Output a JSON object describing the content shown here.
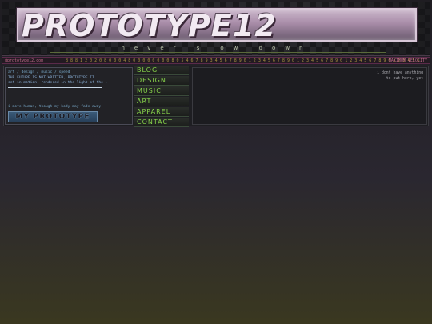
{
  "header": {
    "logo": "PROTOTYPE12",
    "tagline": "never slow down"
  },
  "infobar": {
    "left": "@prototype12.com",
    "middle": "8 8 8 1 2 0 2 0 8 0 0 0 4 8 0 0 0 0 0 0 0 0 8 0 5 4 6 7 8 9 3 4 5 6 7 8 9 0 1 2 3 4 5 6 7 8 9 0 1 2 3 4 5 6 7 8 9 0 1 2 3 4 5 6 7 8 9 0 1 2 3 4 5 6",
    "right": "MAXIMUM VELOCITY"
  },
  "leftbox": {
    "line1": "art / design / music / speed",
    "line2": "THE FUTURE IS NOT WRITTEN, PROTOTYPE IT",
    "line3": "set in motion, rendered in the light of the ▸",
    "line4": "i move human, though my body may fade away",
    "button": "MY PROTOTYPE"
  },
  "nav": {
    "items": [
      "BLOG",
      "DESIGN",
      "MUSIC",
      "ART",
      "APPAREL",
      "CONTACT"
    ]
  },
  "content": {
    "line1": "i dont have anything",
    "line2": "to put here, yet"
  }
}
